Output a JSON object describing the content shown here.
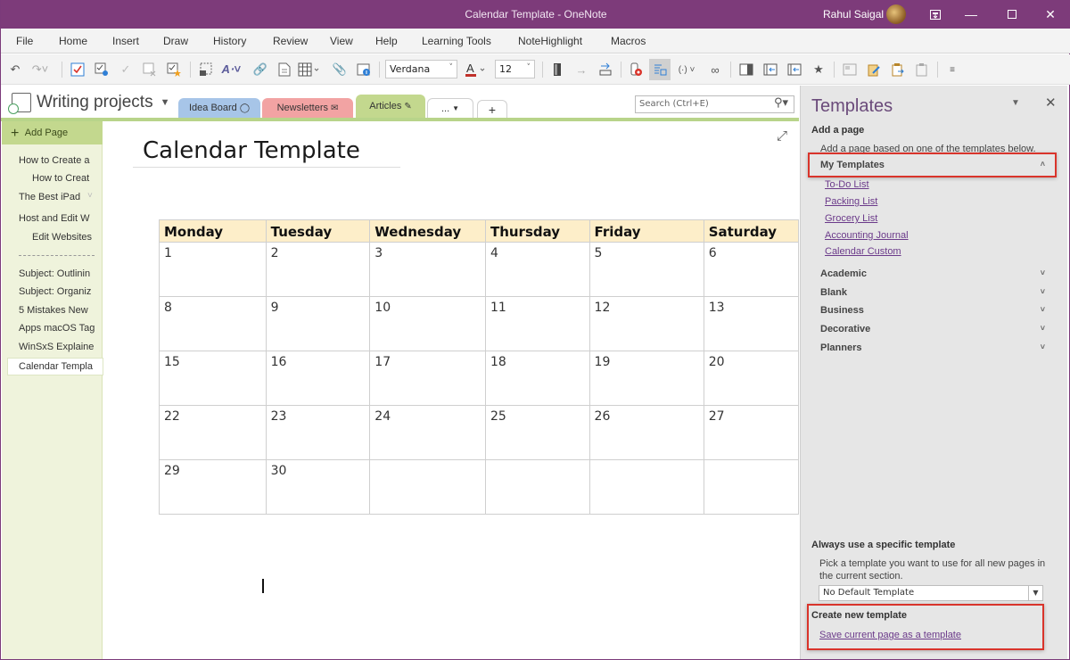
{
  "window": {
    "title": "Calendar Template  -  OneNote",
    "user_name": "Rahul Saigal",
    "controls": [
      "ribbon-display-options",
      "minimize",
      "maximize",
      "close"
    ]
  },
  "menu": [
    "File",
    "Home",
    "Insert",
    "Draw",
    "History",
    "Review",
    "View",
    "Help",
    "Learning Tools",
    "NoteHighlight",
    "Macros"
  ],
  "toolbar": {
    "font_name": "Verdana",
    "font_size": "12",
    "icons": [
      "undo-icon",
      "redo-icon",
      "todo-tag-icon",
      "find-tags-icon",
      "check-icon",
      "remove-tag-icon",
      "important-tag-icon",
      "screen-clipping-icon",
      "format-painter-icon",
      "link-icon",
      "page-icon",
      "table-icon",
      "attach-file-icon",
      "insert-image-icon",
      "font-color-icon",
      "dock-icon",
      "forward-arrow-icon",
      "indent-icon",
      "record-audio-icon",
      "immersive-reader-icon",
      "dictate-icon",
      "spell-check-icon",
      "side-pane-icon",
      "back-icon",
      "forward-page-icon",
      "pin-icon",
      "screenshot-icon",
      "paste-icon",
      "clipboard-icon",
      "clipboard-copy-icon",
      "customize-icon"
    ]
  },
  "notebook": {
    "name": "Writing projects",
    "sections": [
      {
        "label": "Idea Board",
        "color": "#a7c5e8",
        "icon": "lightbulb-icon"
      },
      {
        "label": "Newsletters",
        "color": "#f2a3a3",
        "icon": "envelope-icon"
      },
      {
        "label": "Articles",
        "color": "#c3d88e",
        "icon": "pen-icon",
        "active": true
      },
      {
        "label": "...",
        "color": "#ffffff",
        "icon": "chevron-down-icon"
      },
      {
        "label": "+",
        "color": "#ffffff",
        "icon": "add-section-icon"
      }
    ],
    "search_placeholder": "Search (Ctrl+E)"
  },
  "pages": {
    "add_label": "Add Page",
    "items": [
      {
        "label": "How to Create a",
        "indent": 0
      },
      {
        "label": "How to Creat",
        "indent": 1
      },
      {
        "label": "The Best iPad",
        "indent": 0,
        "collapsible": true
      },
      {
        "label": "Host and Edit W",
        "indent": 0
      },
      {
        "label": "Edit Websites",
        "indent": 1
      },
      {
        "label": "------------------",
        "divider": true
      },
      {
        "label": "Subject: Outlinin",
        "indent": 0
      },
      {
        "label": "Subject: Organiz",
        "indent": 0
      },
      {
        "label": "5 Mistakes New",
        "indent": 0
      },
      {
        "label": "Apps macOS Tag",
        "indent": 0
      },
      {
        "label": "WinSxS Explaine",
        "indent": 0
      },
      {
        "label": "Calendar Templa",
        "indent": 0,
        "selected": true
      }
    ]
  },
  "page": {
    "title": "Calendar Template",
    "calendar": {
      "headers": [
        "Monday",
        "Tuesday",
        "Wednesday",
        "Thursday",
        "Friday",
        "Saturday"
      ],
      "rows": [
        [
          "1",
          "2",
          "3",
          "4",
          "5",
          "6"
        ],
        [
          "8",
          "9",
          "10",
          "11",
          "12",
          "13"
        ],
        [
          "15",
          "16",
          "17",
          "18",
          "19",
          "20"
        ],
        [
          "22",
          "23",
          "24",
          "25",
          "26",
          "27"
        ],
        [
          "29",
          "30",
          "",
          "",
          "",
          ""
        ]
      ]
    }
  },
  "templates_pane": {
    "title": "Templates",
    "add_page_heading": "Add a page",
    "add_page_desc": "Add a page based on one of the templates below.",
    "my_templates": {
      "label": "My Templates",
      "expanded": true,
      "items": [
        "To-Do List",
        "Packing List",
        "Grocery List",
        "Accounting Journal",
        "Calendar Custom"
      ]
    },
    "categories": [
      "Academic",
      "Blank",
      "Business",
      "Decorative",
      "Planners"
    ],
    "always_use_heading": "Always use a specific template",
    "always_use_desc": "Pick a template you want to use for all new pages in the current section.",
    "default_template": "No Default Template",
    "create_heading": "Create new template",
    "save_link": "Save current page as a template"
  },
  "colors": {
    "title_bar": "#7d3b7a",
    "section_accent": "#c3d88e",
    "calendar_header": "#fdeec9",
    "highlight_box": "#d9342b",
    "link": "#6b3a8a"
  }
}
